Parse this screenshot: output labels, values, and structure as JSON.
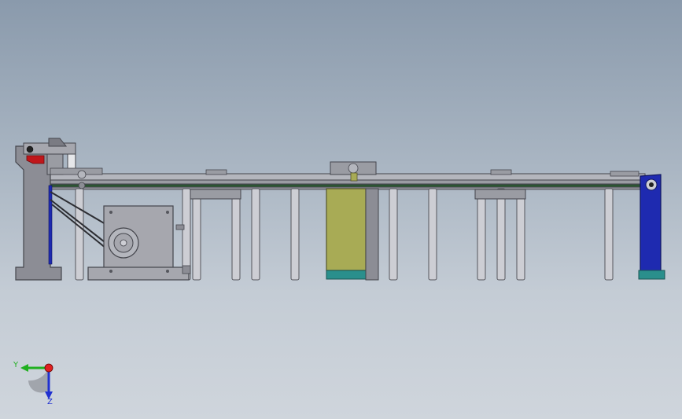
{
  "viewport": {
    "background_top": "#8a9aac",
    "background_bottom": "#cfd5dc"
  },
  "colors": {
    "frame_gray": "#8c8d95",
    "frame_dark": "#5f6068",
    "rail_light": "#b4b6bd",
    "leg_light": "#cdced4",
    "motor_housing": "#a6a7ae",
    "yellow_block": "#a8ab55",
    "teal_base": "#2a8f8c",
    "blue_stand": "#1e2ab0",
    "red_part": "#c0161a",
    "green_strip": "#2f5b36"
  },
  "triad": {
    "y_label": "Y",
    "z_label": "Z",
    "x_color": "#e02020",
    "y_color": "#20b020",
    "z_color": "#2030d0"
  },
  "icons": {
    "view_triad": "axis-triad-icon"
  }
}
